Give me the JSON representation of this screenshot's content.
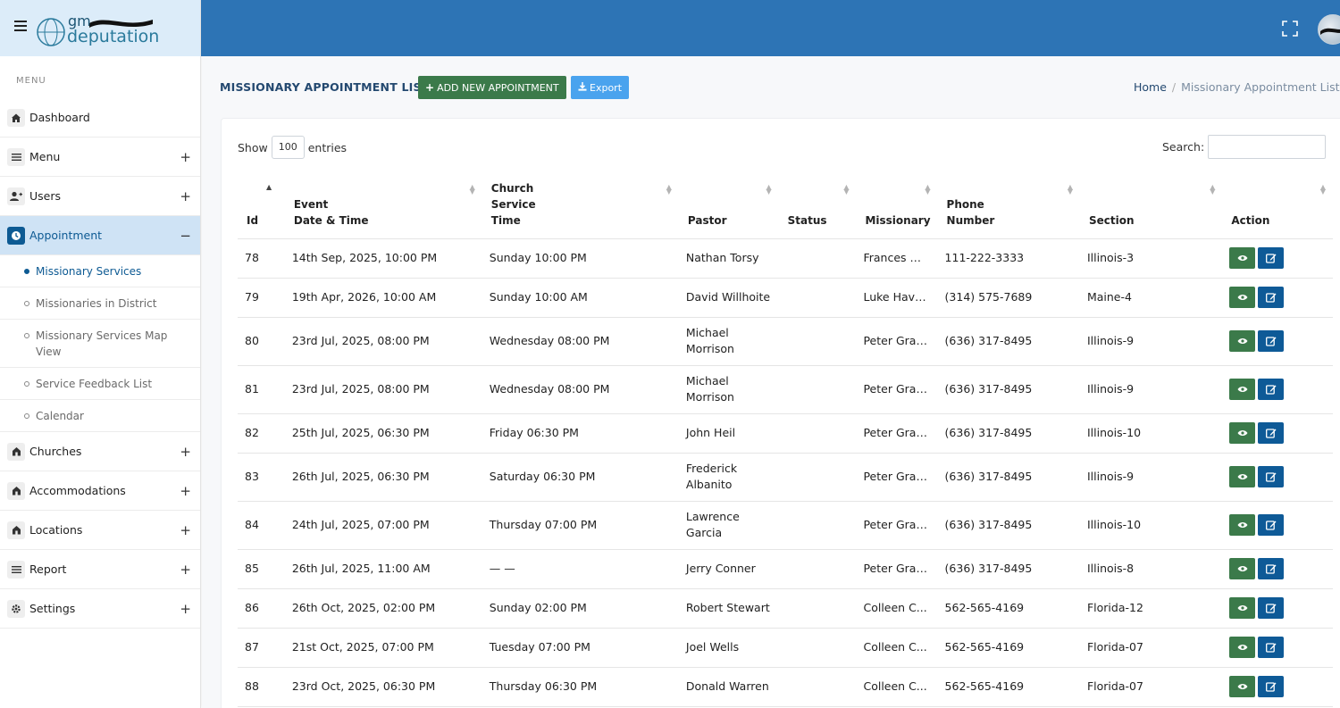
{
  "sidebar": {
    "logo_gm": "gm",
    "logo_deputation": "deputation",
    "menu_label": "MENU",
    "items": [
      {
        "label": "Dashboard",
        "icon": "home-icon",
        "toggle": ""
      },
      {
        "label": "Menu",
        "icon": "list-icon",
        "toggle": "+"
      },
      {
        "label": "Users",
        "icon": "user-plus-icon",
        "toggle": "+"
      },
      {
        "label": "Appointment",
        "icon": "clock-icon",
        "toggle": "−"
      },
      {
        "label": "Churches",
        "icon": "church-icon",
        "toggle": "+"
      },
      {
        "label": "Accommodations",
        "icon": "church-icon",
        "toggle": "+"
      },
      {
        "label": "Locations",
        "icon": "church-icon",
        "toggle": "+"
      },
      {
        "label": "Report",
        "icon": "list-icon",
        "toggle": "+"
      },
      {
        "label": "Settings",
        "icon": "gear-icon",
        "toggle": "+"
      }
    ],
    "subitems": [
      {
        "label": "Missionary Services",
        "active": true
      },
      {
        "label": "Missionaries in District",
        "active": false
      },
      {
        "label": "Missionary Services Map View",
        "active": false
      },
      {
        "label": "Service Feedback List",
        "active": false
      },
      {
        "label": "Calendar",
        "active": false
      }
    ]
  },
  "header": {
    "page_title": "MISSIONARY APPOINTMENT LIST",
    "add_button": "ADD NEW APPOINTMENT",
    "export_button": "Export",
    "breadcrumb_home": "Home",
    "breadcrumb_sep": "/",
    "breadcrumb_current": "Missionary Appointment List"
  },
  "table_controls": {
    "show_label": "Show",
    "entries_value": "100",
    "entries_label": "entries",
    "search_label": "Search:",
    "search_value": ""
  },
  "table": {
    "columns": [
      [
        "Id"
      ],
      [
        "Event",
        "Date & Time"
      ],
      [
        "Church",
        "Service",
        "Time"
      ],
      [
        "Pastor"
      ],
      [
        "Status"
      ],
      [
        "Missionary"
      ],
      [
        "Phone",
        "Number"
      ],
      [
        "Section"
      ],
      [
        "Action"
      ]
    ],
    "rows": [
      {
        "id": "78",
        "datetime": "14th Sep, 2025, 10:00 PM",
        "service_time": "Sunday 10:00 PM",
        "pastor": [
          "Nathan Torsy"
        ],
        "status": "",
        "missionary": "Frances D...",
        "phone": "111-222-3333",
        "section": "Illinois-3"
      },
      {
        "id": "79",
        "datetime": "19th Apr, 2026, 10:00 AM",
        "service_time": "Sunday 10:00 AM",
        "pastor": [
          "David Willhoite"
        ],
        "status": "",
        "missionary": "Luke Have...",
        "phone": "(314) 575-7689",
        "section": "Maine-4"
      },
      {
        "id": "80",
        "datetime": "23rd Jul, 2025, 08:00 PM",
        "service_time": "Wednesday 08:00 PM",
        "pastor": [
          "Michael",
          "Morrison"
        ],
        "status": "",
        "missionary": "Peter Grat...",
        "phone": "(636) 317-8495",
        "section": "Illinois-9"
      },
      {
        "id": "81",
        "datetime": "23rd Jul, 2025, 08:00 PM",
        "service_time": "Wednesday 08:00 PM",
        "pastor": [
          "Michael",
          "Morrison"
        ],
        "status": "",
        "missionary": "Peter Grat...",
        "phone": "(636) 317-8495",
        "section": "Illinois-9"
      },
      {
        "id": "82",
        "datetime": "25th Jul, 2025, 06:30 PM",
        "service_time": "Friday 06:30 PM",
        "pastor": [
          "John Heil"
        ],
        "status": "",
        "missionary": "Peter Grat...",
        "phone": "(636) 317-8495",
        "section": "Illinois-10"
      },
      {
        "id": "83",
        "datetime": "26th Jul, 2025, 06:30 PM",
        "service_time": "Saturday 06:30 PM",
        "pastor": [
          "Frederick",
          "Albanito"
        ],
        "status": "",
        "missionary": "Peter Grat...",
        "phone": "(636) 317-8495",
        "section": "Illinois-9"
      },
      {
        "id": "84",
        "datetime": "24th Jul, 2025, 07:00 PM",
        "service_time": "Thursday 07:00 PM",
        "pastor": [
          "Lawrence",
          "Garcia"
        ],
        "status": "",
        "missionary": "Peter Grat...",
        "phone": "(636) 317-8495",
        "section": "Illinois-10"
      },
      {
        "id": "85",
        "datetime": "26th Jul, 2025, 11:00 AM",
        "service_time": "— —",
        "pastor": [
          "Jerry Conner"
        ],
        "status": "",
        "missionary": "Peter Grat...",
        "phone": "(636) 317-8495",
        "section": "Illinois-8"
      },
      {
        "id": "86",
        "datetime": "26th Oct, 2025, 02:00 PM",
        "service_time": "Sunday 02:00 PM",
        "pastor": [
          "Robert Stewart"
        ],
        "status": "",
        "missionary": "Colleen C...",
        "phone": "562-565-4169",
        "section": "Florida-12"
      },
      {
        "id": "87",
        "datetime": "21st Oct, 2025, 07:00 PM",
        "service_time": "Tuesday 07:00 PM",
        "pastor": [
          "Joel Wells"
        ],
        "status": "",
        "missionary": "Colleen C...",
        "phone": "562-565-4169",
        "section": "Florida-07"
      },
      {
        "id": "88",
        "datetime": "23rd Oct, 2025, 06:30 PM",
        "service_time": "Thursday 06:30 PM",
        "pastor": [
          "Donald Warren"
        ],
        "status": "",
        "missionary": "Colleen C...",
        "phone": "562-565-4169",
        "section": "Florida-07"
      }
    ]
  },
  "colors": {
    "topbar": "#2d74b5",
    "sidebar_header": "#dcecf9",
    "active_nav_bg": "#cfe3f5",
    "brand_dark": "#0d5a93",
    "add_button": "#3b7a4a",
    "export_button": "#4aa3ee",
    "view_button": "#3b7a4a",
    "edit_button": "#0e5a97"
  }
}
